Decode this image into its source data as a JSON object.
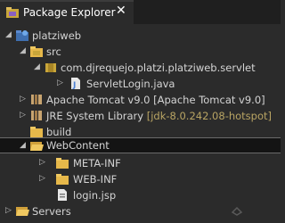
{
  "tab": {
    "title": "Package Explorer",
    "close": "✕"
  },
  "tree": {
    "project": "platziweb",
    "src": "src",
    "package": "com.djrequejo.platzi.platziweb.servlet",
    "servlet_file": "ServletLogin.java",
    "tomcat_lib": "Apache Tomcat v9.0",
    "tomcat_decoration": "[Apache Tomcat v9.0]",
    "jre_lib": "JRE System Library",
    "jre_decoration": "[jdk-8.0.242.08-hotspot]",
    "build": "build",
    "webcontent": "WebContent",
    "metainf": "META-INF",
    "webinf": "WEB-INF",
    "login_jsp": "login.jsp",
    "servers": "Servers"
  },
  "colors": {
    "background": "#2b2b2b",
    "selection": "#141414",
    "folder": "#e6b84a",
    "package": "#c9a63a",
    "java_file": "#4a7fd4",
    "library": "#c8a470"
  }
}
